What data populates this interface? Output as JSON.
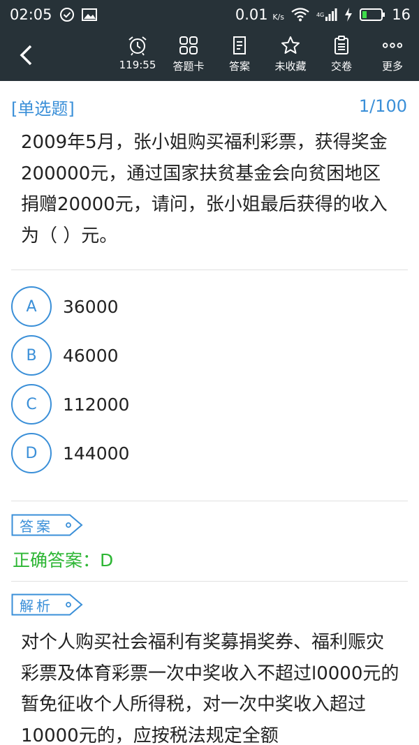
{
  "status_bar": {
    "time": "02:05",
    "speed": "0.01",
    "speed_unit": "K/s",
    "network": "4G",
    "battery": "16"
  },
  "toolbar": {
    "timer": "119:55",
    "answer_card": "答题卡",
    "answer": "答案",
    "favorite": "未收藏",
    "submit": "交卷",
    "more": "更多"
  },
  "question": {
    "type": "[单选题]",
    "counter": "1/100",
    "text": "2009年5月，张小姐购买福利彩票，获得奖金200000元，通过国家扶贫基金会向贫困地区捐赠20000元，请问，张小姐最后获得的收入为（    ）元。"
  },
  "options": [
    {
      "letter": "A",
      "text": "36000"
    },
    {
      "letter": "B",
      "text": "46000"
    },
    {
      "letter": "C",
      "text": "112000"
    },
    {
      "letter": "D",
      "text": "144000"
    }
  ],
  "answer_section": {
    "tag": "答案",
    "text": "正确答案：D"
  },
  "explanation_section": {
    "tag": "解析",
    "text": "对个人购买社会福利有奖募捐奖券、福利赈灾彩票及体育彩票一次中奖收入不超过l0000元的暂免征收个人所得税，对一次中奖收入超过10000元的，应按税法规定全额"
  },
  "colors": {
    "header_bg": "#273238",
    "accent": "#3a8fd8",
    "correct": "#2db634"
  }
}
